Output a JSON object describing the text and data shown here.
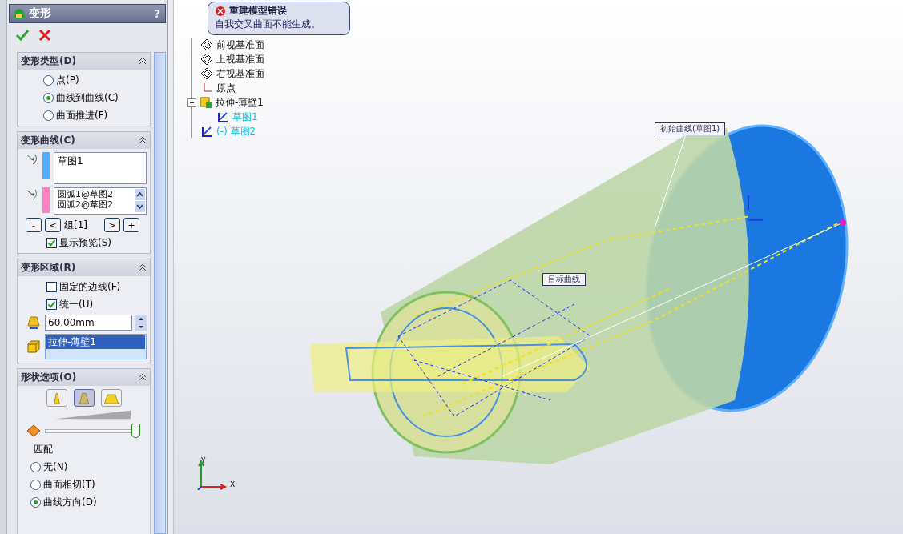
{
  "panel": {
    "title": "变形",
    "help": "?"
  },
  "deform_type": {
    "title": "变形类型(D)",
    "options": [
      {
        "label": "点(P)",
        "selected": false
      },
      {
        "label": "曲线到曲线(C)",
        "selected": true
      },
      {
        "label": "曲面推进(F)",
        "selected": false
      }
    ]
  },
  "deform_curves": {
    "title": "变形曲线(C)",
    "initial_curves": [
      "草图1"
    ],
    "target_curves": [
      "圆弧1@草图2",
      "圆弧2@草图2"
    ],
    "nav_buttons": [
      "-",
      "<",
      ">",
      "+"
    ],
    "group": "组[1]",
    "show_preview": {
      "label": "显示预览(S)",
      "checked": true
    }
  },
  "deform_region": {
    "title": "变形区域(R)",
    "fixed_edges": {
      "label": "固定的边线(F)",
      "checked": false
    },
    "uniform": {
      "label": "统一(U)",
      "checked": true
    },
    "radius": "60.00mm",
    "body": "拉伸-薄壁1"
  },
  "shape_options": {
    "title": "形状选项(O)",
    "shape_buttons": [
      {
        "selected": false
      },
      {
        "selected": true
      },
      {
        "selected": false
      }
    ],
    "stiffness": {
      "level": 0.97
    },
    "match_label": "匹配",
    "match_options": [
      {
        "label": "无(N)",
        "selected": false
      },
      {
        "label": "曲面相切(T)",
        "selected": false
      },
      {
        "label": "曲线方向(D)",
        "selected": true
      }
    ]
  },
  "tree": [
    {
      "label": "前视基准面",
      "kind": "plane"
    },
    {
      "label": "上视基准面",
      "kind": "plane"
    },
    {
      "label": "右视基准面",
      "kind": "plane"
    },
    {
      "label": "原点",
      "kind": "origin"
    },
    {
      "label": "拉伸-薄壁1",
      "kind": "feature",
      "expanded": true,
      "children": [
        {
          "label": "草图1",
          "kind": "sketch"
        }
      ]
    },
    {
      "label": "(-) 草图2",
      "kind": "sketch"
    }
  ],
  "error": {
    "title": "重建模型错误",
    "message": "自我交叉曲面不能生成。"
  },
  "viewport": {
    "labels": [
      "初始曲线(草图1)",
      "目标曲线"
    ],
    "axes": {
      "y": "Y",
      "x": "X"
    }
  }
}
